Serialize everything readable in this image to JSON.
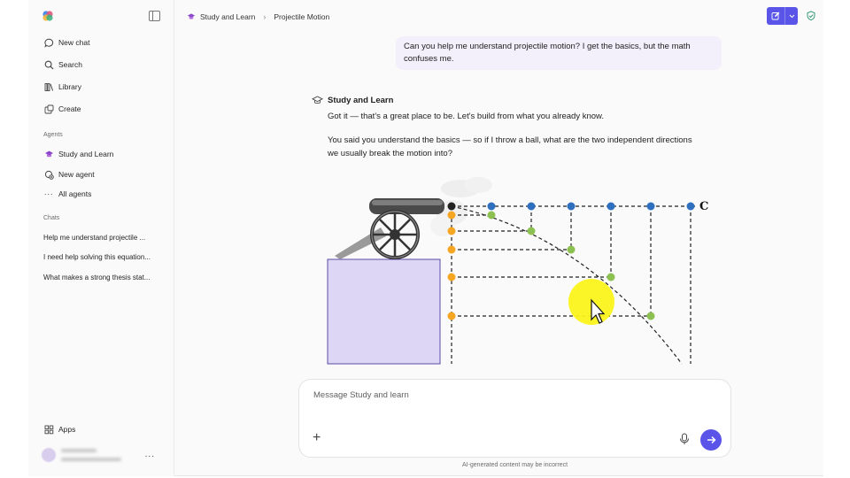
{
  "colors": {
    "accent": "#5a55e8",
    "user_bubble": "#f3effb",
    "cursor_highlight": "#fbf31b"
  },
  "sidebar": {
    "nav": [
      {
        "label": "New chat",
        "icon": "chat-bubble-icon"
      },
      {
        "label": "Search",
        "icon": "search-icon"
      },
      {
        "label": "Library",
        "icon": "library-icon"
      },
      {
        "label": "Create",
        "icon": "create-icon"
      }
    ],
    "agents_label": "Agents",
    "agents": [
      {
        "label": "Study and Learn",
        "icon": "graduation-cap-icon"
      },
      {
        "label": "New agent",
        "icon": "new-agent-icon"
      },
      {
        "label": "All agents",
        "icon": "ellipsis-icon"
      }
    ],
    "chats_label": "Chats",
    "chats": [
      "Help me understand projectile ...",
      "I need help solving this equation...",
      "What makes a strong thesis stat..."
    ],
    "apps_label": "Apps",
    "more_label": "..."
  },
  "header": {
    "breadcrumb_agent": "Study and Learn",
    "breadcrumb_sep": "›",
    "breadcrumb_page": "Projectile Motion"
  },
  "conversation": {
    "user_message": "Can you help me understand projectile motion? I get the basics, but the math confuses me.",
    "agent_name": "Study and Learn",
    "agent_paragraphs": [
      "Got it — that's a great place to be. Let's build from what you already know.",
      "You said you understand the basics — so if I throw a ball, what are the two independent directions we usually break the motion into?"
    ],
    "figure_label": "C"
  },
  "composer": {
    "placeholder": "Message Study and learn",
    "plus_label": "+",
    "disclaimer": "AI-generated content may be incorrect"
  }
}
